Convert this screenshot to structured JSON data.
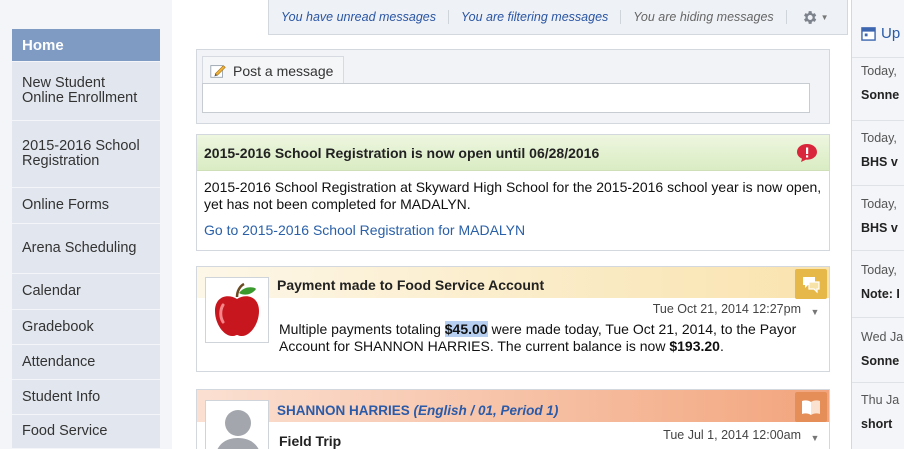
{
  "sidebar": {
    "items": [
      {
        "label": "Home",
        "active": true
      },
      {
        "label": "New Student Online Enrollment"
      },
      {
        "label": "2015-2016 School Registration"
      },
      {
        "label": "Online Forms"
      },
      {
        "label": "Arena Scheduling"
      },
      {
        "label": "Calendar"
      },
      {
        "label": "Gradebook"
      },
      {
        "label": "Attendance"
      },
      {
        "label": "Student Info"
      },
      {
        "label": "Food Service"
      }
    ]
  },
  "toolbar": {
    "unread": "You have unread messages",
    "filtering": "You are filtering messages",
    "hiding": "You are hiding messages",
    "settings_icon": "gear-icon"
  },
  "post": {
    "tab_label": "Post a message",
    "input_value": ""
  },
  "registration": {
    "title": "2015-2016 School Registration is now open until 06/28/2016",
    "body": "2015-2016 School Registration at Skyward High School for the 2015-2016 school year is now open, yet has not been completed for MADALYN.",
    "link": "Go to 2015-2016 School Registration for MADALYN",
    "alert_color": "#d9263b"
  },
  "payment": {
    "title": "Payment made to Food Service Account",
    "timestamp": "Tue Oct 21, 2014 12:27pm",
    "text_before": "Multiple payments totaling ",
    "amount": "$45.00",
    "text_after": " were made today, Tue Oct 21, 2014, to the Payor Account for SHANNON HARRIES. The current balance is now ",
    "balance": "$193.20",
    "text_end": ".",
    "header_color": "#f9e3ae"
  },
  "teacher_post": {
    "teacher": "SHANNON HARRIES",
    "course": "(English / 01, Period 1)",
    "timestamp": "Tue Jul 1, 2014 12:00am",
    "subject": "Field Trip",
    "header_color": "#f2a57d"
  },
  "upcoming": {
    "title": "Up",
    "items": [
      {
        "date": "Today,",
        "text": "Sonne"
      },
      {
        "date": "Today,",
        "text": "BHS v"
      },
      {
        "date": "Today,",
        "text": "BHS v"
      },
      {
        "date": "Today,",
        "text": "Note: I"
      },
      {
        "date": "Wed Ja",
        "text": "Sonne"
      },
      {
        "date": "Thu Ja",
        "text": "short"
      }
    ]
  }
}
